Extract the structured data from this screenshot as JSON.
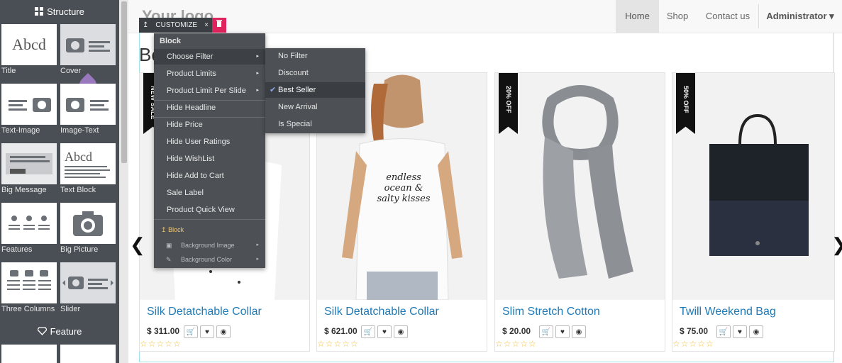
{
  "sidebar": {
    "structure_title": "Structure",
    "feature_title": "Feature",
    "snippets": [
      {
        "label": "Title",
        "thumb_text": "Abcd"
      },
      {
        "label": "Cover"
      },
      {
        "label": "Text-Image"
      },
      {
        "label": "Image-Text"
      },
      {
        "label": "Big Message"
      },
      {
        "label": "Text Block",
        "thumb_text": "Abcd"
      },
      {
        "label": "Features"
      },
      {
        "label": "Big Picture"
      },
      {
        "label": "Three Columns"
      },
      {
        "label": "Slider"
      }
    ]
  },
  "navbar": {
    "logo": "Your logo",
    "items": [
      "Home",
      "Shop",
      "Contact us"
    ],
    "active": "Home",
    "user": "Administrator ▾"
  },
  "customize_bar": {
    "label": "CUSTOMIZE",
    "close_icon": "×",
    "handle_icon": "↥"
  },
  "section": {
    "heading_fragment": "Be"
  },
  "menu": {
    "header": "Block",
    "items": [
      {
        "label": "Choose Filter",
        "has_sub": true,
        "active": true
      },
      {
        "label": "Product Limits",
        "has_sub": true
      },
      {
        "label": "Product Limit Per Slide",
        "has_sub": true
      },
      {
        "label": "Hide Headline"
      },
      {
        "label": "Hide Price"
      },
      {
        "label": "Hide User Ratings"
      },
      {
        "label": "Hide WishList"
      },
      {
        "label": "Hide Add to Cart"
      },
      {
        "label": "Sale Label"
      },
      {
        "label": "Product Quick View"
      }
    ],
    "block_label": "Block",
    "options": [
      {
        "label": "Background Image"
      },
      {
        "label": "Background Color"
      }
    ]
  },
  "submenu": {
    "items": [
      {
        "label": "No Filter"
      },
      {
        "label": "Discount"
      },
      {
        "label": "Best Seller",
        "checked": true
      },
      {
        "label": "New Arrival"
      },
      {
        "label": "Is Special"
      }
    ]
  },
  "products": [
    {
      "name": "Silk Detatchable Collar",
      "price": "$ 311.00",
      "ribbon": "NEW SALE",
      "image": "shirt"
    },
    {
      "name": "Silk Detatchable Collar",
      "price": "$ 621.00",
      "ribbon": "",
      "image": "tank-top",
      "print": "endless ocean & salty kisses"
    },
    {
      "name": "Slim Stretch Cotton",
      "price": "$ 20.00",
      "ribbon": "20% OFF",
      "image": "scarf"
    },
    {
      "name": "Twill Weekend Bag",
      "price": "$ 75.00",
      "ribbon": "50% OFF",
      "image": "bag"
    }
  ],
  "ratings_stars": "☆☆☆☆☆",
  "colors": {
    "sidebar_bg": "#4a4f55",
    "menu_bg": "#4d5156",
    "product_link": "#1f7ab5",
    "delete_button": "#e0245e"
  }
}
